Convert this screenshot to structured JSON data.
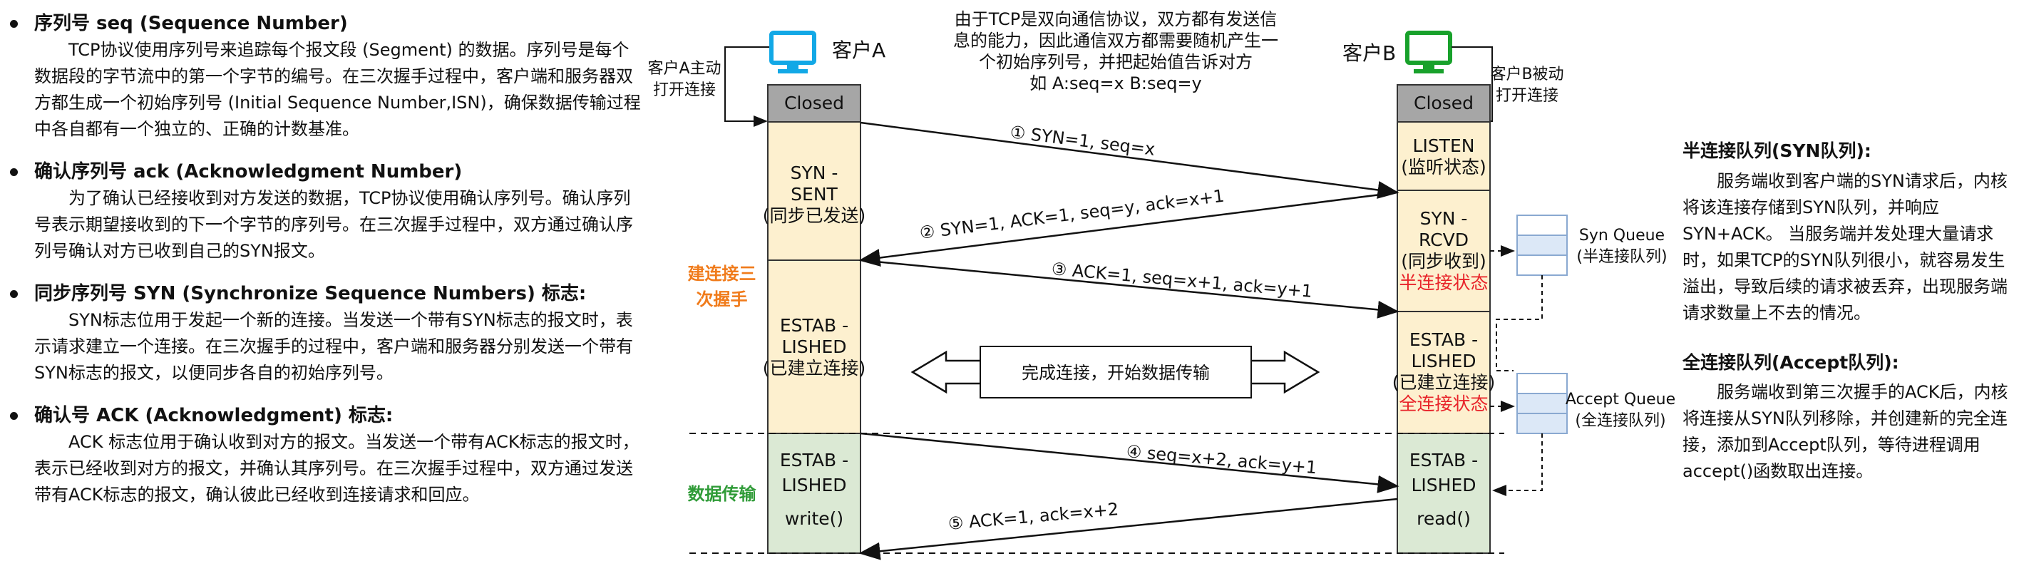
{
  "left": {
    "items": [
      {
        "title": "序列号 seq (Sequence Number)",
        "body": "TCP协议使用序列号来追踪每个报文段 (Segment) 的数据。序列号是每个数据段的字节流中的第一个字节的编号。在三次握手过程中，客户端和服务器双方都生成一个初始序列号 (Initial Sequence Number,ISN)，确保数据传输过程中各自都有一个独立的、正确的计数基准。"
      },
      {
        "title": "确认序列号 ack (Acknowledgment Number)",
        "body": "为了确认已经接收到对方发送的数据，TCP协议使用确认序列号。确认序列号表示期望接收到的下一个字节的序列号。在三次握手过程中，双方通过确认序列号确认对方已收到自己的SYN报文。"
      },
      {
        "title": "同步序列号 SYN (Synchronize Sequence Numbers) 标志:",
        "body": "SYN标志位用于发起一个新的连接。当发送一个带有SYN标志的报文时，表示请求建立一个连接。在三次握手的过程中，客户端和服务器分别发送一个带有SYN标志的报文，以便同步各自的初始序列号。"
      },
      {
        "title": "确认号 ACK (Acknowledgment) 标志:",
        "body": "ACK 标志位用于确认收到对方的报文。当发送一个带有ACK标志的报文时，表示已经收到对方的报文，并确认其序列号。在三次握手过程中，双方通过发送带有ACK标志的报文，确认彼此已经收到连接请求和回应。"
      }
    ]
  },
  "diagram": {
    "top_note": [
      "由于TCP是双向通信协议，双方都有发送信",
      "息的能力，因此通信双方都需要随机产生一",
      "个初始序列号，并把起始值告诉对方",
      "如  A:seq=x    B:seq=y"
    ],
    "client_a": {
      "label": "客户A",
      "open_note": [
        "客户A主动",
        "打开连接"
      ]
    },
    "client_b": {
      "label": "客户B",
      "open_note": [
        "客户B被动",
        "打开连接"
      ]
    },
    "a_states": {
      "closed": "Closed",
      "syn_sent": [
        "SYN -",
        "SENT",
        "(同步已发送)"
      ],
      "established": [
        "ESTAB -",
        "LISHED",
        "(已建立连接)"
      ],
      "data": [
        "ESTAB -",
        "LISHED",
        "",
        "write()"
      ]
    },
    "b_states": {
      "closed": "Closed",
      "listen": [
        "LISTEN",
        "(监听状态)"
      ],
      "syn_rcvd": [
        "SYN -",
        "RCVD",
        "(同步收到)"
      ],
      "syn_rcvd_note": "半连接状态",
      "established": [
        "ESTAB -",
        "LISHED",
        "(已建立连接)"
      ],
      "established_note": "全连接状态",
      "data": [
        "ESTAB -",
        "LISHED",
        "",
        "read()"
      ]
    },
    "messages": [
      "① SYN=1,  seq=x",
      "② SYN=1,  ACK=1,  seq=y,  ack=x+1",
      "③ ACK=1,  seq=x+1,  ack=y+1",
      "④ seq=x+2,  ack=y+1",
      "⑤ ACK=1,  ack=x+2"
    ],
    "phase_handshake": [
      "建连接三",
      "次握手"
    ],
    "phase_data": "数据传输",
    "complete_label": "完成连接，开始数据传输",
    "syn_queue": [
      "Syn Queue",
      "(半连接队列)"
    ],
    "accept_queue": [
      "Accept Queue",
      "(全连接队列)"
    ],
    "colors": {
      "state_fill": "#fdf0cf",
      "data_fill": "#dbe9d4",
      "closed_fill": "#a6a6a6",
      "client_a": "#12a8e6",
      "client_b": "#18a12b",
      "queue_fill": "#dce8f7",
      "queue_stroke": "#8aa9d1"
    }
  },
  "right": {
    "syn_title": "半连接队列(SYN队列):",
    "syn_body": "服务端收到客户端的SYN请求后，内核将该连接存储到SYN队列，并响应SYN+ACK。 当服务端并发处理大量请求时，如果TCP的SYN队列很小，就容易发生溢出，导致后续的请求被丢弃，出现服务端请求数量上不去的情况。",
    "accept_title": "全连接队列(Accept队列):",
    "accept_body": "服务端收到第三次握手的ACK后，内核将连接从SYN队列移除，并创建新的完全连接，添加到Accept队列，等待进程调用accept()函数取出连接。"
  }
}
